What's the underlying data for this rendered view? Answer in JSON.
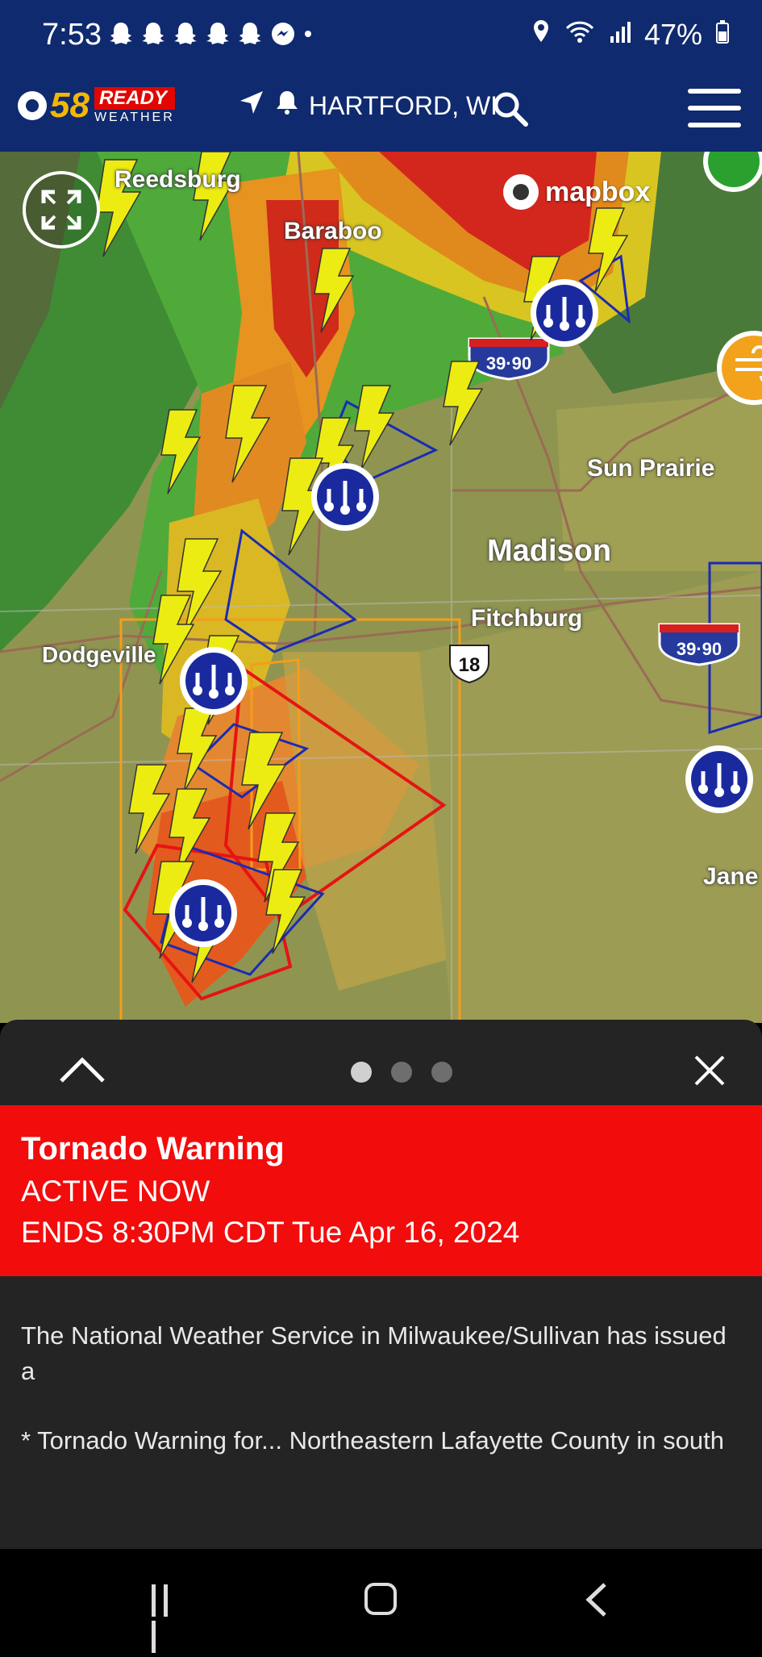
{
  "status_bar": {
    "time": "7:53",
    "battery": "47%"
  },
  "header": {
    "logo_number": "58",
    "logo_ready": "READY",
    "logo_weather": "WEATHER",
    "location": "HARTFORD, WI"
  },
  "map": {
    "attribution": "mapbox",
    "cities": [
      "Reedsburg",
      "Baraboo",
      "Sun Prairie",
      "Madison",
      "Fitchburg",
      "Dodgeville",
      "Jane"
    ],
    "highway_labels": [
      "39·90",
      "39·90",
      "18"
    ]
  },
  "alert": {
    "title": "Tornado Warning",
    "status": "ACTIVE NOW",
    "ends": "ENDS 8:30PM CDT Tue Apr 16, 2024",
    "body_1": "The National Weather Service in Milwaukee/Sullivan has issued a",
    "body_2": "* Tornado Warning for... Northeastern Lafayette County in south central Wisconsin... Northwestern",
    "page_indicator": {
      "current": 1,
      "total": 3
    }
  },
  "colors": {
    "header_bg": "#0f2a6e",
    "alert_red": "#f20c0c",
    "sheet_bg": "#242424"
  }
}
